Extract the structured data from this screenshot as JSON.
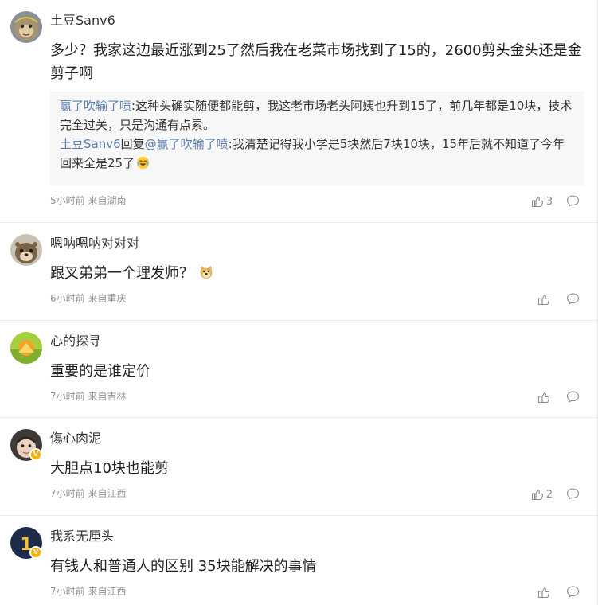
{
  "comments": [
    {
      "username": "土豆Sanv6",
      "text": "多少？我家这边最近涨到25了然后我在老菜市场找到了15的，2600剪头金头还是金剪子啊",
      "replies": [
        {
          "author": "赢了吹输了喷",
          "sep": ":",
          "text": "这种头确实随便都能剪，我这老市场老头阿姨也升到15了，前几年都是10块，技术完全过关，只是沟通有点累。"
        },
        {
          "author": "土豆Sanv6",
          "reply_word": "回复",
          "target": "@赢了吹输了喷",
          "sep": ":",
          "text": "我清楚记得我小学是5块然后7块10块，15年后就不知道了今年回来全是25了",
          "emoji": "laugh-cry-emoji"
        }
      ],
      "meta": "5小时前 来自湖南",
      "likes": "3",
      "avatar": "monkey-avatar",
      "verified": false
    },
    {
      "username": "嗯呐嗯呐对对对",
      "text": "跟叉弟弟一个理发师？",
      "emoji": "doge-emoji",
      "meta": "6小时前 来自重庆",
      "likes": "",
      "avatar": "otter-avatar",
      "verified": false
    },
    {
      "username": "心的探寻",
      "text": "重要的是谁定价",
      "meta": "7小时前 来自吉林",
      "likes": "",
      "avatar": "sunset-avatar",
      "verified": false
    },
    {
      "username": "傷心肉泥",
      "text": "大胆点10块也能剪",
      "meta": "7小时前 来自江西",
      "likes": "2",
      "avatar": "baby-avatar",
      "verified": true
    },
    {
      "username": "我系无厘头",
      "text": "有钱人和普通人的区别 35块能解决的事情",
      "meta": "7小时前 来自江西",
      "likes": "",
      "avatar": "number-one-avatar",
      "verified": true
    }
  ],
  "colors": {
    "link": "#5a7fb1",
    "meta": "#939393",
    "reply_bg": "#f7f7f7",
    "verified_badge": "#f5b200"
  },
  "icons": {
    "like": "thumb-up-icon",
    "reply": "comment-bubble-icon",
    "verified": "verified-v-icon"
  }
}
